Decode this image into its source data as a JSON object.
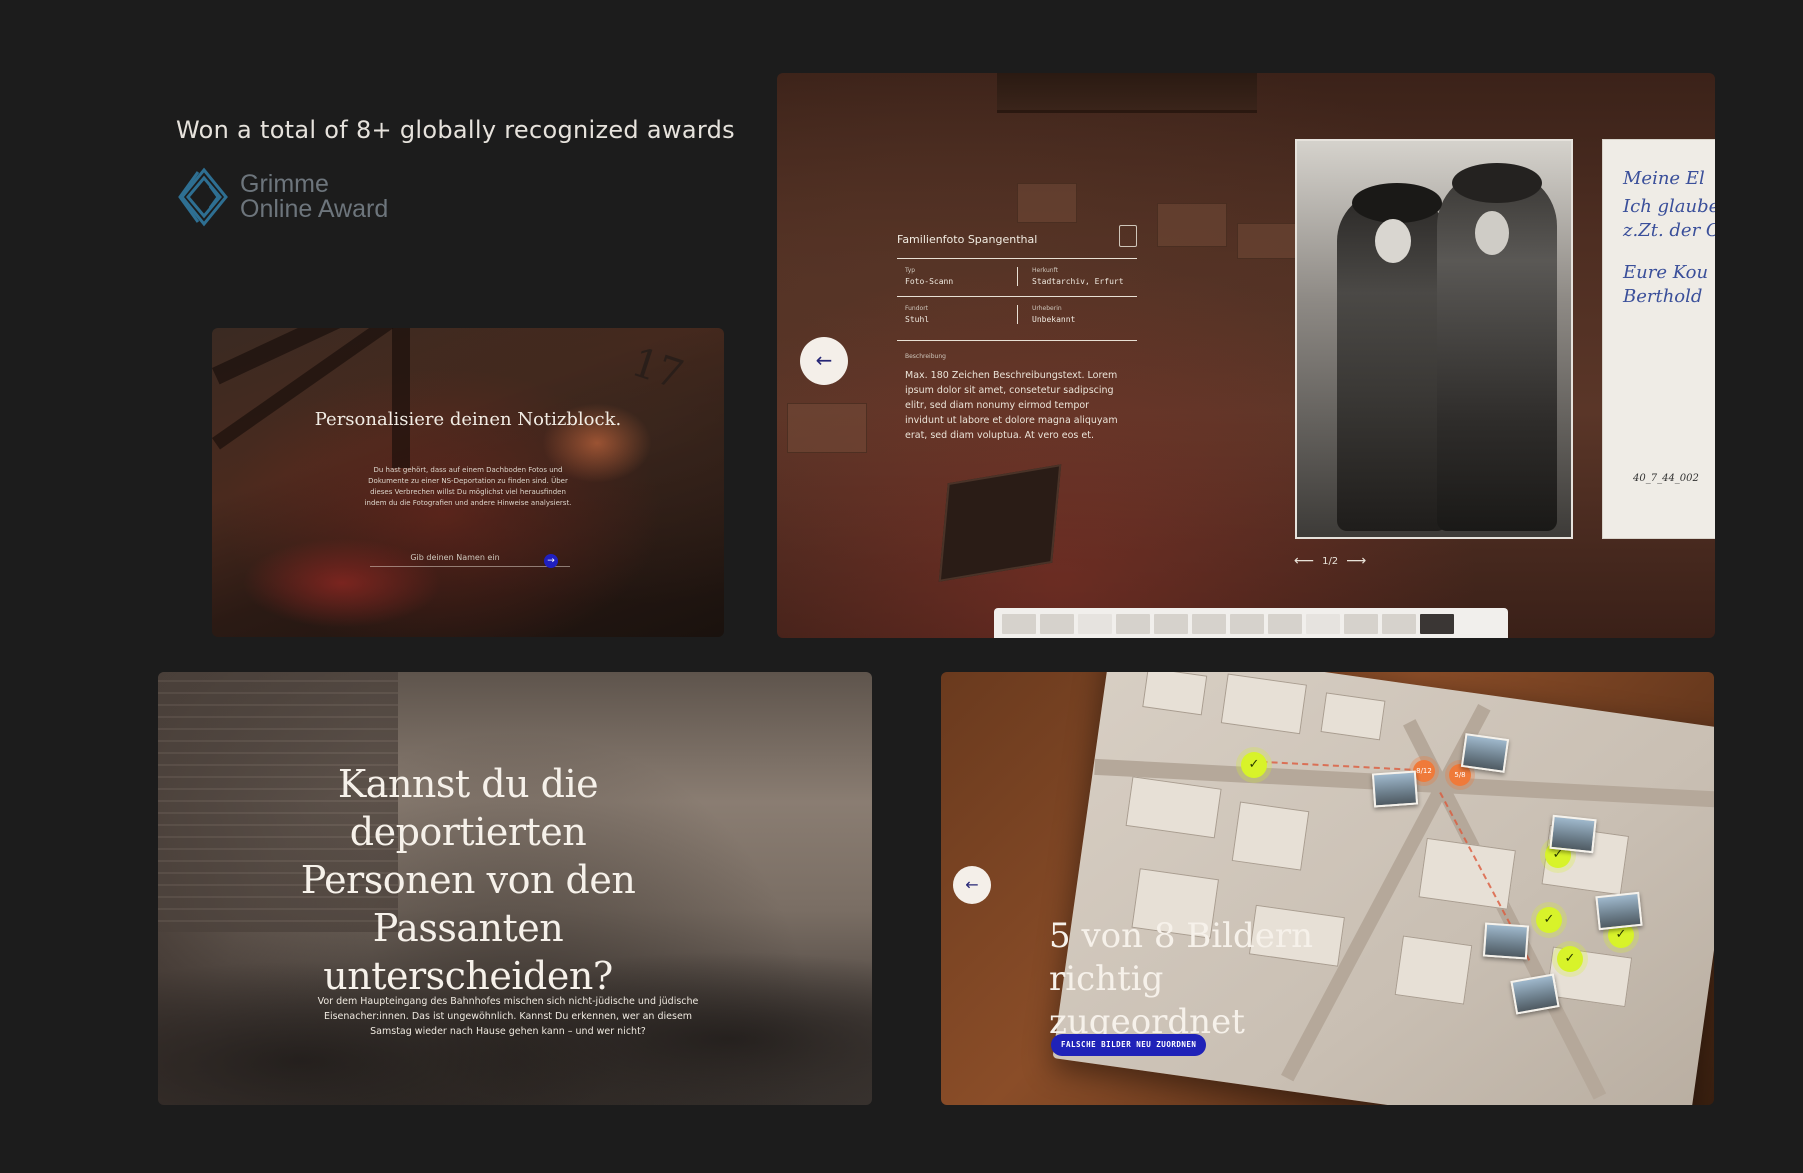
{
  "awards": {
    "heading": "Won a total of 8+ globally recognized awards",
    "logo_line1": "Grimme",
    "logo_line2": "Online Award"
  },
  "notebook_panel": {
    "title": "Personalisiere deinen Notizblock.",
    "body": "Du hast gehört, dass auf einem Dachboden Fotos und Dokumente zu einer NS-Deportation zu finden sind. Über dieses Verbrechen willst Du möglichst viel herausfinden indem du die Fotografien und andere Hinweise analysierst.",
    "input_placeholder": "Gib deinen Namen ein",
    "submit_icon": "→",
    "wall_number": "17"
  },
  "photo_panel": {
    "title": "Familienfoto Spangenthal",
    "fields": [
      {
        "label": "Typ",
        "value": "Foto-Scann"
      },
      {
        "label": "Herkunft",
        "value": "Stadtarchiv, Erfurt"
      },
      {
        "label": "Fundort",
        "value": "Stuhl"
      },
      {
        "label": "Urheberin",
        "value": "Unbekannt"
      }
    ],
    "description_label": "Beschreibung",
    "description": "Max. 180 Zeichen Beschreibungstext. Lorem ipsum dolor sit amet, consetetur sadipscing elitr, sed diam nonumy eirmod tempor invidunt ut labore et dolore magna aliquyam erat, sed diam voluptua. At vero eos et.",
    "back_icon": "←",
    "pager": {
      "prev": "⟵",
      "label": "1/2",
      "next": "⟶"
    },
    "letter_lines": [
      "Meine El",
      "Ich glaube",
      "z.Zt. der O",
      "Eure Kou",
      "Berthold"
    ],
    "letter_ref": "40_7_44_002"
  },
  "deportation_panel": {
    "title": "Kannst du die deportierten Personen von den Passanten unterscheiden?",
    "body": "Vor dem Haupteingang des Bahnhofes mischen sich nicht-jüdische und jüdische Eisenacher:innen. Das ist ungewöhnlich. Kannst Du erkennen, wer an diesem Samstag wieder nach Hause gehen kann – und wer nicht?"
  },
  "map_panel": {
    "back_icon": "←",
    "result": "5 von 8 Bildern richtig zugeordnet",
    "button_label": "FALSCHE BILDER NEU ZUORDNEN",
    "pin_orange_1": "8/12",
    "pin_orange_2": "5/8",
    "accent_color": "#d8f32a",
    "button_color": "#1f22b8"
  }
}
